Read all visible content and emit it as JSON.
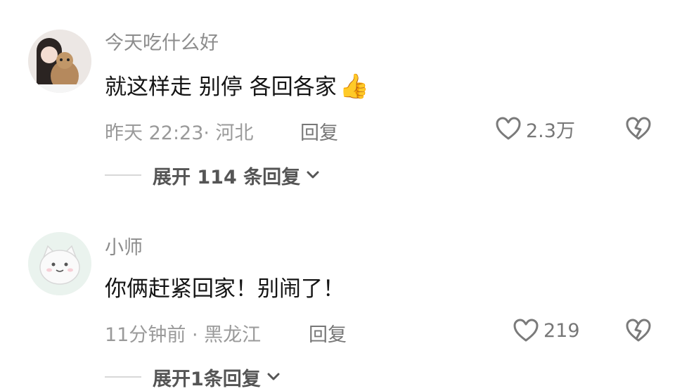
{
  "comments": [
    {
      "username": "今天吃什么好",
      "text": "就这样走 别停 各回各家",
      "emoji": "👍",
      "meta": "昨天 22:23· 河北",
      "reply_label": "回复",
      "like_count": "2.3万",
      "expand_label": "展开 114 条回复"
    },
    {
      "username": "小师",
      "text": "你俩赶紧回家！别闹了！",
      "meta": "11分钟前 · 黑龙江",
      "reply_label": "回复",
      "like_count": "219",
      "expand_label": "展开1条回复"
    }
  ],
  "icons": {
    "like": "heart-outline-icon",
    "dislike": "broken-heart-icon",
    "expand": "chevron-down-icon",
    "emoji": "thumbs-up-icon"
  },
  "colors": {
    "text": "#141414",
    "muted": "#9a9a9a",
    "icon": "#7a7a7a"
  }
}
